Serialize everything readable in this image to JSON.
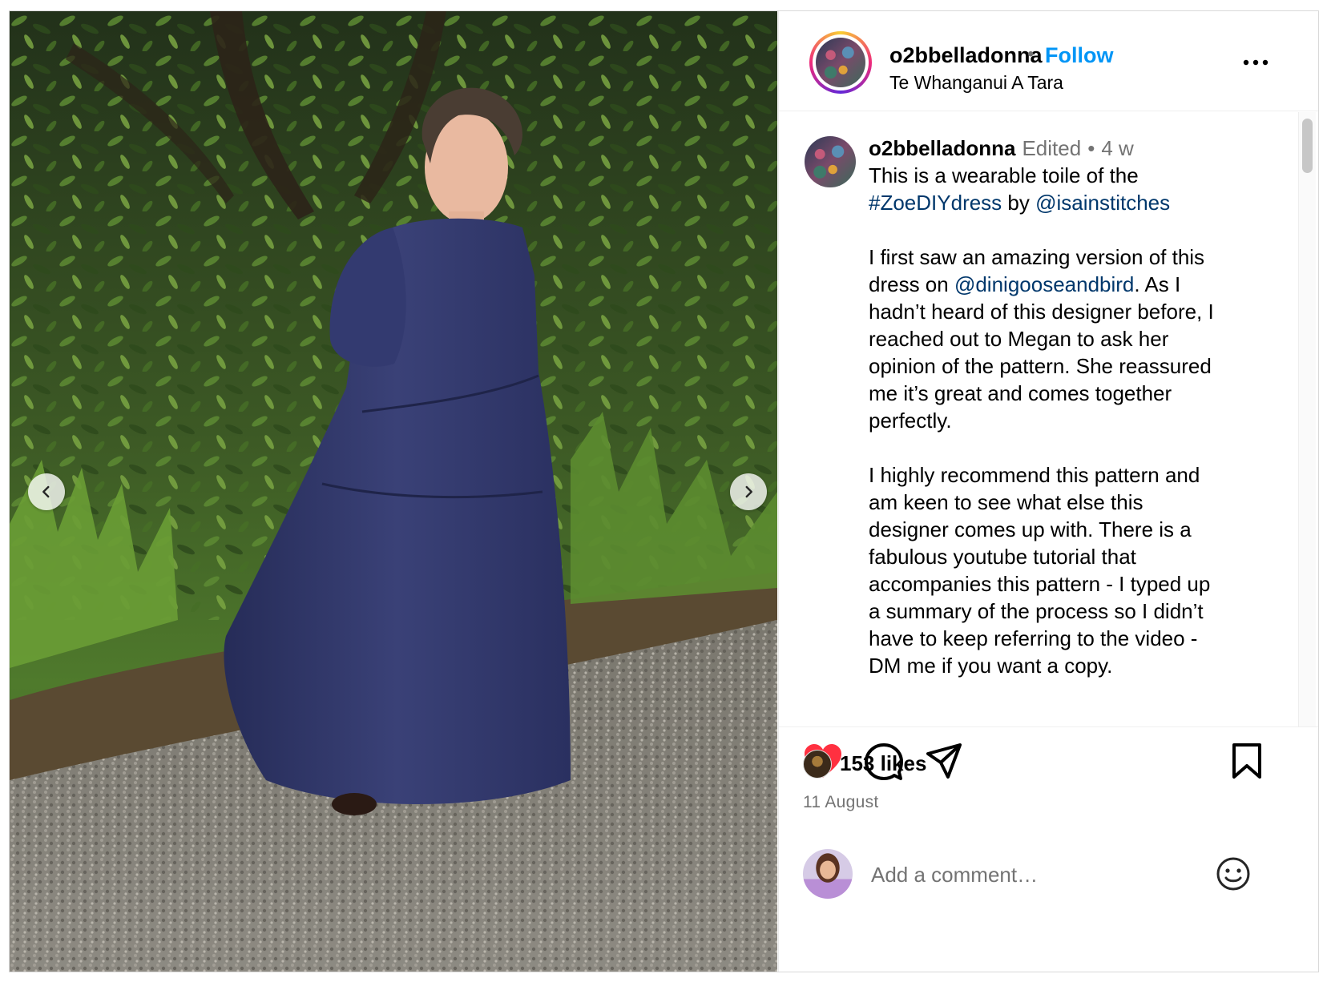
{
  "post": {
    "username": "o2bbelladonna",
    "follow_label": "Follow",
    "dot": "•",
    "location": "Te Whanganui A Tara",
    "media_description_icon": "photo-woman-in-navy-tiered-dress"
  },
  "caption": {
    "username": "o2bbelladonna",
    "edited": "Edited",
    "separator": "•",
    "time": "4 w",
    "lines": [
      [
        "This is a wearable toile of the"
      ],
      [
        {
          "link": "#ZoeDIYdress"
        },
        " by ",
        {
          "link": "@isainstitches"
        }
      ],
      [],
      [
        "I first saw an amazing version of this"
      ],
      [
        "dress on ",
        {
          "link": "@dinigooseandbird"
        },
        ". As I"
      ],
      [
        "hadn’t heard of this designer before, I"
      ],
      [
        "reached out to Megan to ask her"
      ],
      [
        "opinion of the pattern. She reassured"
      ],
      [
        "me it’s great and comes together"
      ],
      [
        "perfectly."
      ],
      [],
      [
        "I highly recommend this pattern and"
      ],
      [
        "am keen to see what else this"
      ],
      [
        "designer comes up with. There is a"
      ],
      [
        "fabulous youtube tutorial that"
      ],
      [
        "accompanies this pattern - I typed up"
      ],
      [
        "a summary of the process so I didn’t"
      ],
      [
        "have to keep referring to the video -"
      ],
      [
        "DM me if you want a copy."
      ]
    ]
  },
  "actions": {
    "liked": true,
    "like_color": "#ff3040",
    "icons": [
      "heart-icon",
      "comment-icon",
      "share-icon",
      "bookmark-icon"
    ]
  },
  "likes_text": "153 likes",
  "date": "11 August",
  "comment": {
    "placeholder": "Add a comment…",
    "emoji_icon": "smiley-icon"
  },
  "colors": {
    "follow": "#0095f6",
    "link": "#00376b",
    "muted": "#737373",
    "dress": "#2e3566"
  }
}
